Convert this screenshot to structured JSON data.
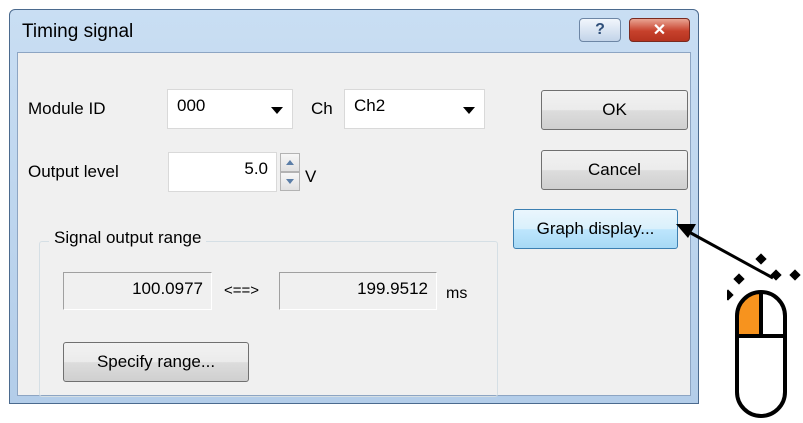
{
  "window": {
    "title": "Timing signal",
    "help_label": "?",
    "close_label": "✕"
  },
  "module": {
    "label": "Module ID",
    "value": "000"
  },
  "channel": {
    "label": "Ch",
    "value": "Ch2"
  },
  "output_level": {
    "label": "Output level",
    "value": "5.0",
    "unit": "V"
  },
  "range_group": {
    "title": "Signal output range",
    "start": "100.0977",
    "separator": "<==>",
    "end": "199.9512",
    "unit": "ms",
    "specify_label": "Specify range..."
  },
  "buttons": {
    "ok": "OK",
    "cancel": "Cancel",
    "graph": "Graph display..."
  },
  "annotation": {
    "arrow_color": "#000000",
    "mouse_highlight_color": "#f7931e",
    "icon": "mouse-left-click-icon"
  }
}
